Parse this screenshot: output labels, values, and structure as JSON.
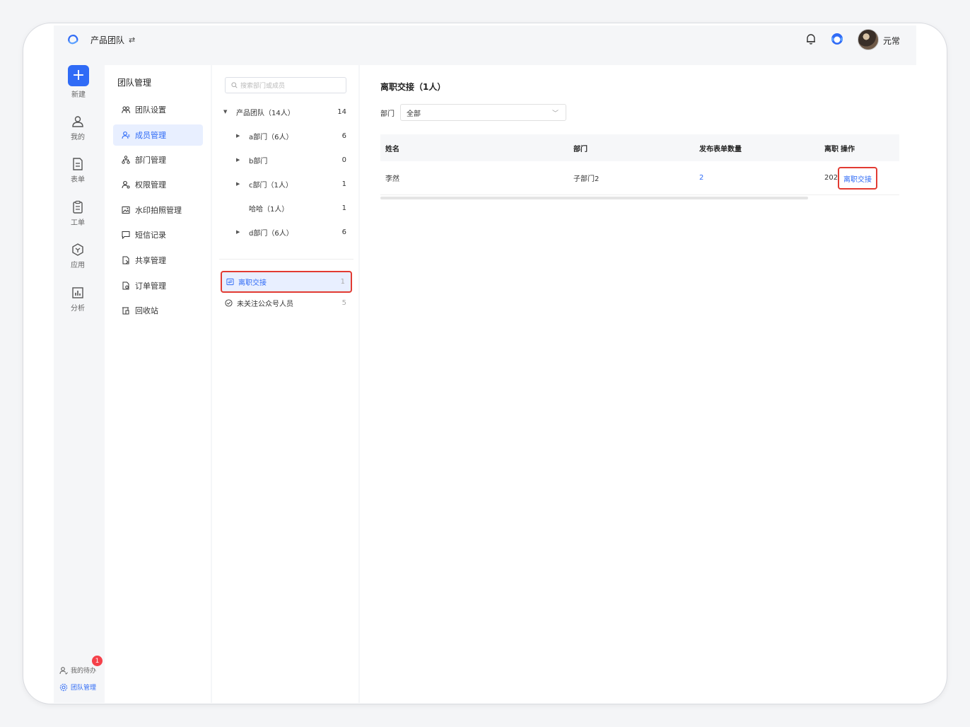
{
  "header": {
    "team_name": "产品团队",
    "swap_icon": "⇄",
    "username": "元常"
  },
  "rail": {
    "new_label": "新建",
    "items": [
      {
        "label": "我的",
        "icon": "user-icon"
      },
      {
        "label": "表单",
        "icon": "form-icon"
      },
      {
        "label": "工单",
        "icon": "clipboard-icon"
      },
      {
        "label": "应用",
        "icon": "hexagon-icon"
      },
      {
        "label": "分析",
        "icon": "chart-icon"
      }
    ],
    "todo_label": "我的待办",
    "todo_badge": "1",
    "team_manage_label": "团队管理"
  },
  "menu": {
    "title": "团队管理",
    "items": [
      {
        "label": "团队设置"
      },
      {
        "label": "成员管理"
      },
      {
        "label": "部门管理"
      },
      {
        "label": "权限管理"
      },
      {
        "label": "水印拍照管理"
      },
      {
        "label": "短信记录"
      },
      {
        "label": "共享管理"
      },
      {
        "label": "订单管理"
      },
      {
        "label": "回收站"
      }
    ],
    "active_index": 1
  },
  "tree": {
    "search_placeholder": "搜索部门或成员",
    "rows": [
      {
        "label": "产品团队（14人）",
        "count": "14"
      },
      {
        "label": "a部门（6人）",
        "count": "6"
      },
      {
        "label": "b部门",
        "count": "0"
      },
      {
        "label": "c部门（1人）",
        "count": "1"
      },
      {
        "label": "哈哈（1人）",
        "count": "1"
      },
      {
        "label": "d部门（6人）",
        "count": "6"
      }
    ],
    "special": [
      {
        "label": "离职交接",
        "count": "1"
      },
      {
        "label": "未关注公众号人员",
        "count": "5"
      }
    ]
  },
  "content": {
    "title": "离职交接（1人）",
    "filter_label": "部门",
    "filter_value": "全部",
    "columns": [
      "姓名",
      "部门",
      "发布表单数量",
      "离职",
      "操作"
    ],
    "rows": [
      {
        "name": "李然",
        "dept": "子部门2",
        "forms": "2",
        "date": "202",
        "action": "离职交接"
      }
    ]
  },
  "colors": {
    "accent": "#2f6bf6",
    "highlight": "#e23b32"
  }
}
